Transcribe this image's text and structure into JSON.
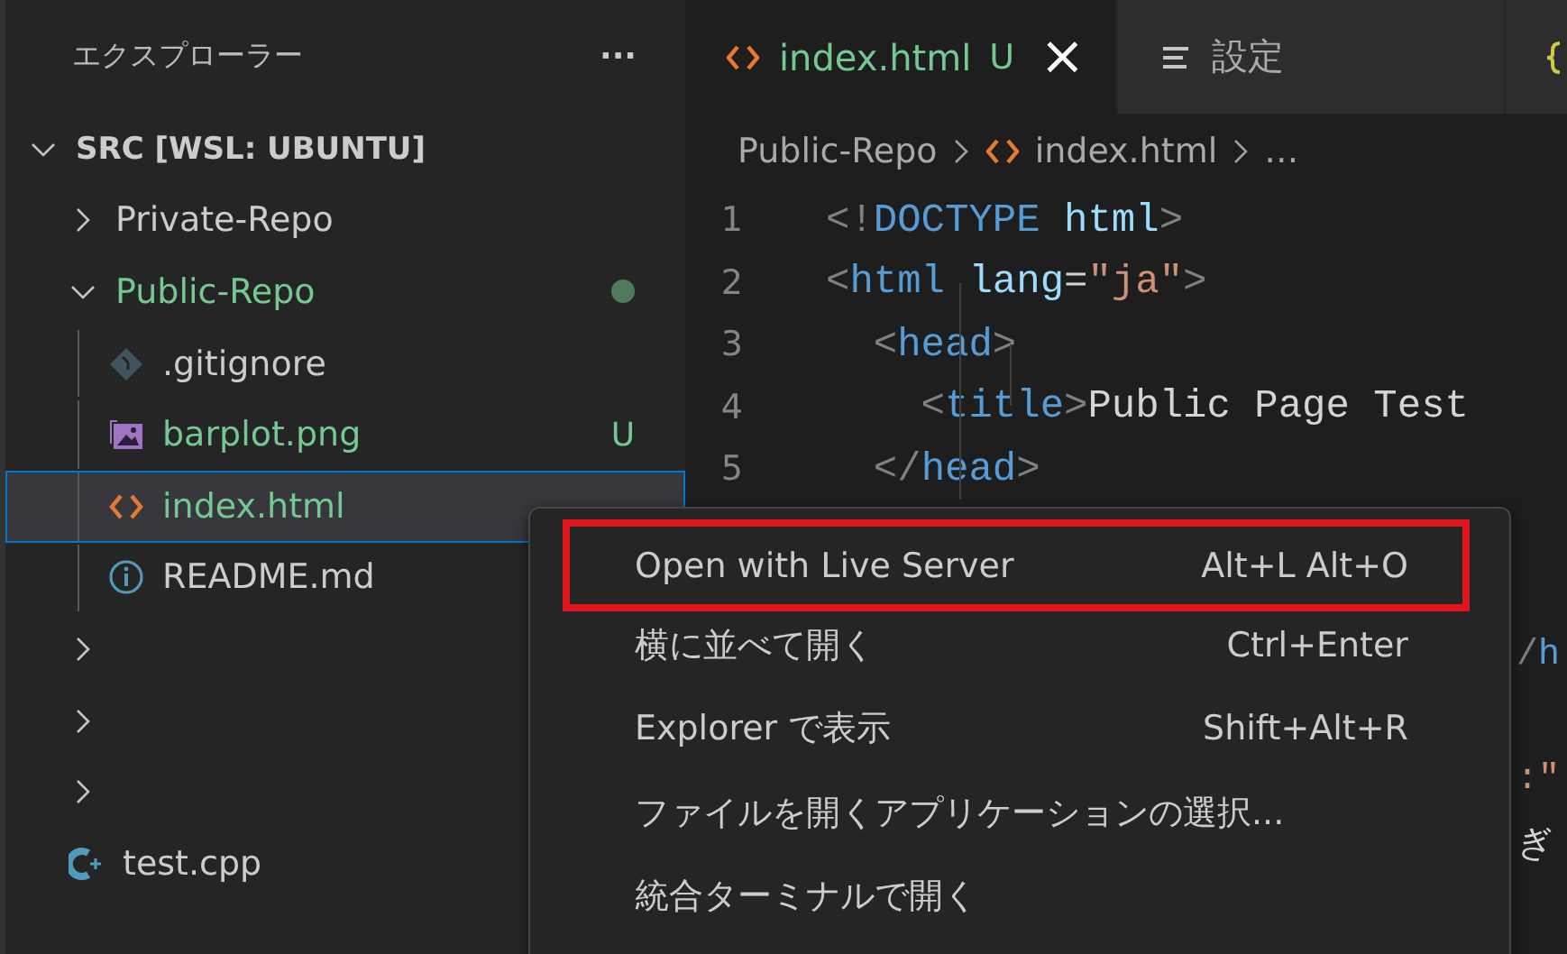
{
  "sidebar": {
    "title": "エクスプローラー",
    "more": "···",
    "tree": [
      {
        "label": "SRC [WSL: UBUNTU]",
        "kind": "root",
        "expanded": true,
        "children": [
          {
            "label": "Private-Repo",
            "kind": "folder",
            "expanded": false
          },
          {
            "label": "Public-Repo",
            "kind": "folder",
            "expanded": true,
            "untracked": true,
            "modified": true,
            "children": [
              {
                "label": ".gitignore",
                "kind": "git",
                "untracked": false,
                "selected": false
              },
              {
                "label": "barplot.png",
                "kind": "image",
                "untracked": true,
                "status": "U",
                "selected": false
              },
              {
                "label": "index.html",
                "kind": "html",
                "untracked": true,
                "selected": true
              },
              {
                "label": "README.md",
                "kind": "info",
                "untracked": false,
                "selected": false
              }
            ]
          },
          {
            "kind": "folder",
            "expanded": false
          },
          {
            "kind": "folder",
            "expanded": false
          },
          {
            "kind": "folder",
            "expanded": false
          },
          {
            "label": "test.cpp",
            "kind": "cpp",
            "untracked": false,
            "selected": false
          }
        ]
      }
    ]
  },
  "tabs": [
    {
      "label": "index.html",
      "kind": "html",
      "status": "U",
      "close": "×",
      "selected": true
    },
    {
      "label": "設定",
      "kind": "settings",
      "selected": false
    },
    {
      "kind": "json",
      "selected": false
    }
  ],
  "breadcrumb": [
    {
      "label": "Public-Repo",
      "kind": "folder"
    },
    {
      "label": "index.html",
      "kind": "html"
    },
    {
      "label": "…",
      "kind": "more"
    }
  ],
  "code": [
    {
      "number": "1",
      "tokens": [
        {
          "text": "<!",
          "kind": "punct"
        },
        {
          "text": "DOCTYPE",
          "kind": "tag"
        },
        {
          "text": " html",
          "kind": "attr"
        },
        {
          "text": ">",
          "kind": "punct"
        }
      ]
    },
    {
      "number": "2",
      "tokens": [
        {
          "text": "<",
          "kind": "punct"
        },
        {
          "text": "html",
          "kind": "tag"
        },
        {
          "text": " lang",
          "kind": "attr"
        },
        {
          "text": "=",
          "kind": "plain"
        },
        {
          "text": "\"ja\"",
          "kind": "string"
        },
        {
          "text": ">",
          "kind": "punct"
        }
      ]
    },
    {
      "number": "3",
      "tokens": [
        {
          "text": "  <",
          "kind": "punct"
        },
        {
          "text": "head",
          "kind": "tag"
        },
        {
          "text": ">",
          "kind": "punct"
        }
      ]
    },
    {
      "number": "4",
      "tokens": [
        {
          "text": "    <",
          "kind": "punct"
        },
        {
          "text": "title",
          "kind": "tag"
        },
        {
          "text": ">",
          "kind": "punct"
        },
        {
          "text": "Public Page Test",
          "kind": "plain"
        }
      ]
    },
    {
      "number": "5",
      "tokens": [
        {
          "text": "  </",
          "kind": "punct"
        },
        {
          "text": "head",
          "kind": "tag"
        },
        {
          "text": ">",
          "kind": "punct"
        }
      ]
    }
  ],
  "code_fragments": [
    {
      "tokens": [
        {
          "text": "/",
          "kind": "punct"
        },
        {
          "text": "h",
          "kind": "tag"
        }
      ]
    },
    {
      "tokens": [
        {
          "text": ":\"",
          "kind": "string"
        }
      ]
    },
    {
      "tokens": [
        {
          "text": "ぎ",
          "kind": "plain"
        }
      ]
    }
  ],
  "context_menu": [
    {
      "label": "Open with Live Server",
      "shortcut": "Alt+L Alt+O",
      "highlighted": true
    },
    {
      "label": "横に並べて開く",
      "shortcut": "Ctrl+Enter",
      "highlighted": false
    },
    {
      "label": "Explorer で表示",
      "shortcut": "Shift+Alt+R",
      "highlighted": false
    },
    {
      "label": "ファイルを開くアプリケーションの選択...",
      "highlighted": false
    },
    {
      "label": "統合ターミナルで開く",
      "highlighted": false
    }
  ]
}
